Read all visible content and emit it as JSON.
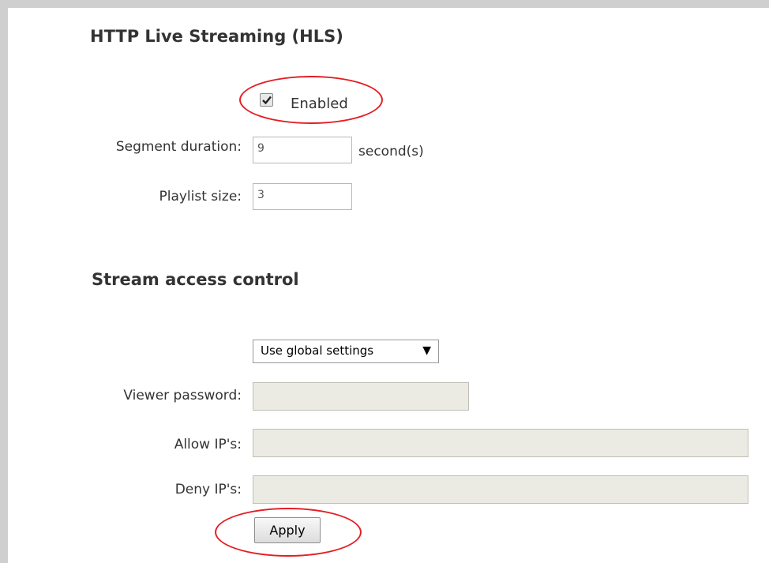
{
  "hls": {
    "title": "HTTP Live Streaming (HLS)",
    "enabled_label": "Enabled",
    "enabled": true,
    "segment_duration_label": "Segment duration:",
    "segment_duration_value": "9",
    "segment_duration_unit": "second(s)",
    "playlist_size_label": "Playlist size:",
    "playlist_size_value": "3"
  },
  "access": {
    "title": "Stream access control",
    "mode_selected": "Use global settings",
    "viewer_password_label": "Viewer password:",
    "allow_ips_label": "Allow IP's:",
    "deny_ips_label": "Deny IP's:"
  },
  "actions": {
    "apply_label": "Apply"
  },
  "icons": {
    "checkbox": "checkmark-icon",
    "dropdown": "triangle-down-icon"
  },
  "colors": {
    "highlight": "#e31e24",
    "frame": "#cfcfcf",
    "disabled_field": "#ebebe4"
  }
}
